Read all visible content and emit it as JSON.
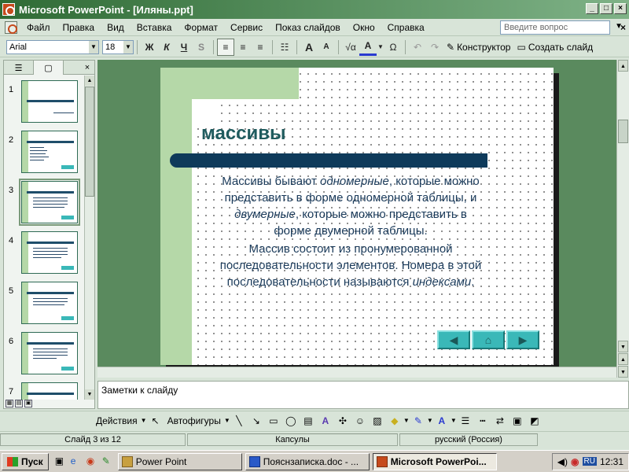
{
  "window": {
    "title": "Microsoft PowerPoint - [Иляны.ppt]",
    "controls": [
      "_",
      "□",
      "×"
    ]
  },
  "menu": {
    "items": [
      "Файл",
      "Правка",
      "Вид",
      "Вставка",
      "Формат",
      "Сервис",
      "Показ слайдов",
      "Окно",
      "Справка"
    ],
    "help_placeholder": "Введите вопрос",
    "close": "×"
  },
  "toolbar": {
    "font": "Arial",
    "size": "18",
    "bold": "Ж",
    "italic": "К",
    "underline": "Ч",
    "shadow": "S",
    "constructor": "Конструктор",
    "new_slide": "Создать слайд"
  },
  "left_pane": {
    "thumbnails": [
      "1",
      "2",
      "3",
      "4",
      "5",
      "6",
      "7"
    ],
    "active_index": 2
  },
  "slide": {
    "title": "массивы",
    "para1_pre": "Массивы бывают ",
    "para1_em1": "одномерные",
    "para1_mid": ", которые можно представить в форме одномерной таблицы, и ",
    "para1_em2": "двумерные",
    "para1_post": ", которые можно представить в форме двумерной таблицы.",
    "para2_pre": "Массив состоит из пронумерованной последовательности элементов. Номера в этой последовательности называются ",
    "para2_em": "индексами",
    "para2_post": ".",
    "colors": {
      "title": "#1f5b5e",
      "bar": "#0e3a5a",
      "green": "#b5d8a8",
      "nav": "#3ab8b8"
    }
  },
  "notes": {
    "text": "Заметки к слайду"
  },
  "drawing_toolbar": {
    "actions": "Действия",
    "autoshapes": "Автофигуры"
  },
  "status": {
    "slide": "Слайд 3 из 12",
    "design": "Капсулы",
    "language": "русский (Россия)"
  },
  "taskbar": {
    "start": "Пуск",
    "tasks": [
      "Power Point",
      "Пояснзаписка.doc - ...",
      "Microsoft PowerPoi..."
    ],
    "lang": "RU",
    "time": "12:31"
  }
}
